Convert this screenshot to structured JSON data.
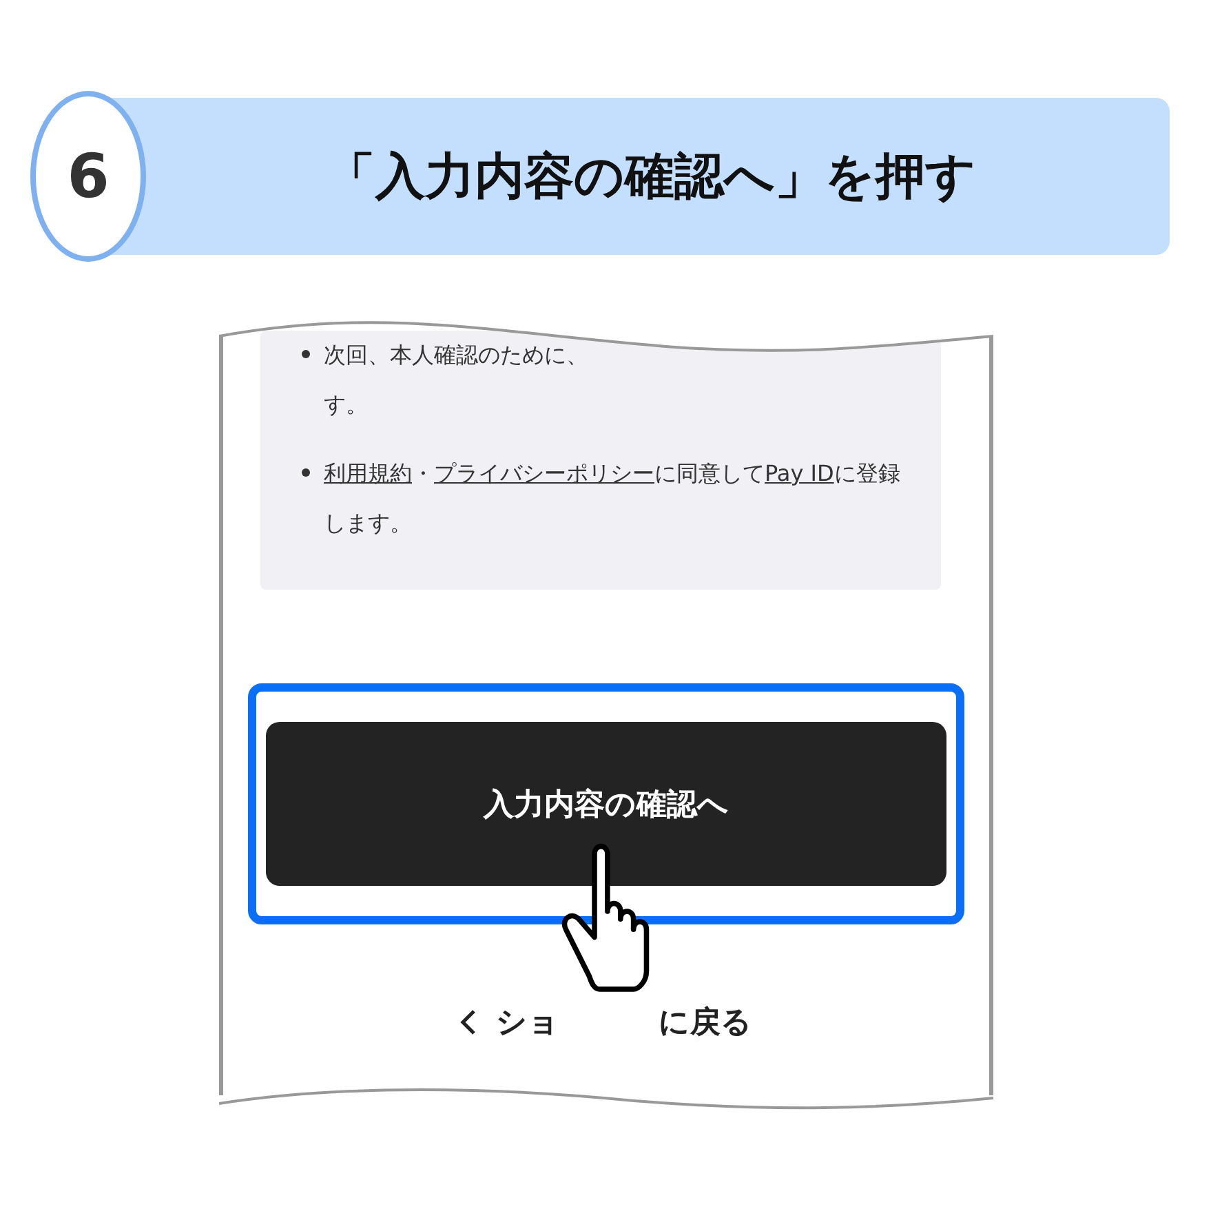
{
  "step": {
    "number": "6",
    "title": "「入力内容の確認へ」を押す"
  },
  "notes": [
    {
      "parts": [
        {
          "text": "次回、本人確認のために、",
          "link": false
        }
      ],
      "continuation": "す。"
    },
    {
      "parts": [
        {
          "text": "利用規約",
          "link": true
        },
        {
          "text": "・",
          "link": false
        },
        {
          "text": "プライバシーポリシー",
          "link": true
        },
        {
          "text": "に同意して",
          "link": false
        },
        {
          "text": "Pay ID",
          "link": true
        },
        {
          "text": "に登録",
          "link": false
        }
      ],
      "continuation": "します。"
    }
  ],
  "primary_button": {
    "label": "入力内容の確認へ",
    "highlighted": true
  },
  "back_link": {
    "visible_start": "ショ",
    "visible_end": "に戻る"
  }
}
